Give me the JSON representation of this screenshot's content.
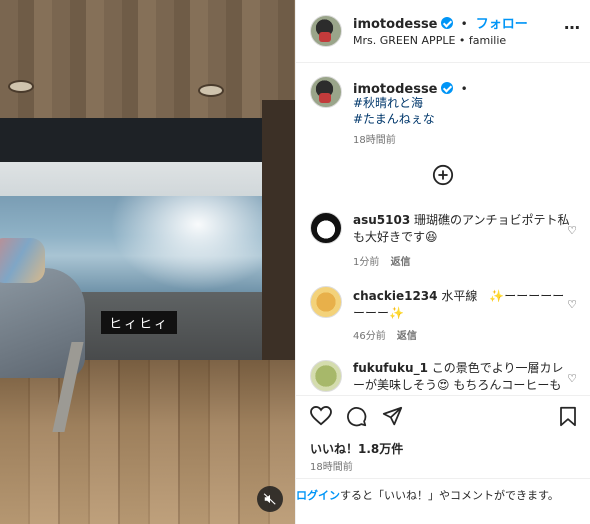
{
  "caption_overlay": "ヒィヒィ",
  "header": {
    "username": "imotodesse",
    "separator": "•",
    "follow_label": "フォロー",
    "subtitle": "Mrs. GREEN APPLE • familie",
    "more": "…"
  },
  "post": {
    "username": "imotodesse",
    "separator": "•",
    "hashtags": [
      "#秋晴れと海",
      "#たまんねぇな"
    ],
    "time": "18時間前"
  },
  "comments": [
    {
      "user": "asu5103",
      "text": "珊瑚礁のアンチョビポテト私も大好きです😆",
      "time": "1分前",
      "reply": "返信"
    },
    {
      "user": "chackie1234",
      "text": "水平線　✨ーーーーーーーー✨",
      "time": "46分前",
      "reply": "返信"
    },
    {
      "user": "fukufuku_1",
      "text": "この景色でより一層カレーが美味しそう😍 もちろんコーヒーも✨",
      "time": "",
      "reply": ""
    }
  ],
  "likes": "いいね！1.8万件",
  "post_time": "18時間前",
  "footer": {
    "login_link": "ログイン",
    "rest": "すると「いいね！」やコメントができます。"
  }
}
